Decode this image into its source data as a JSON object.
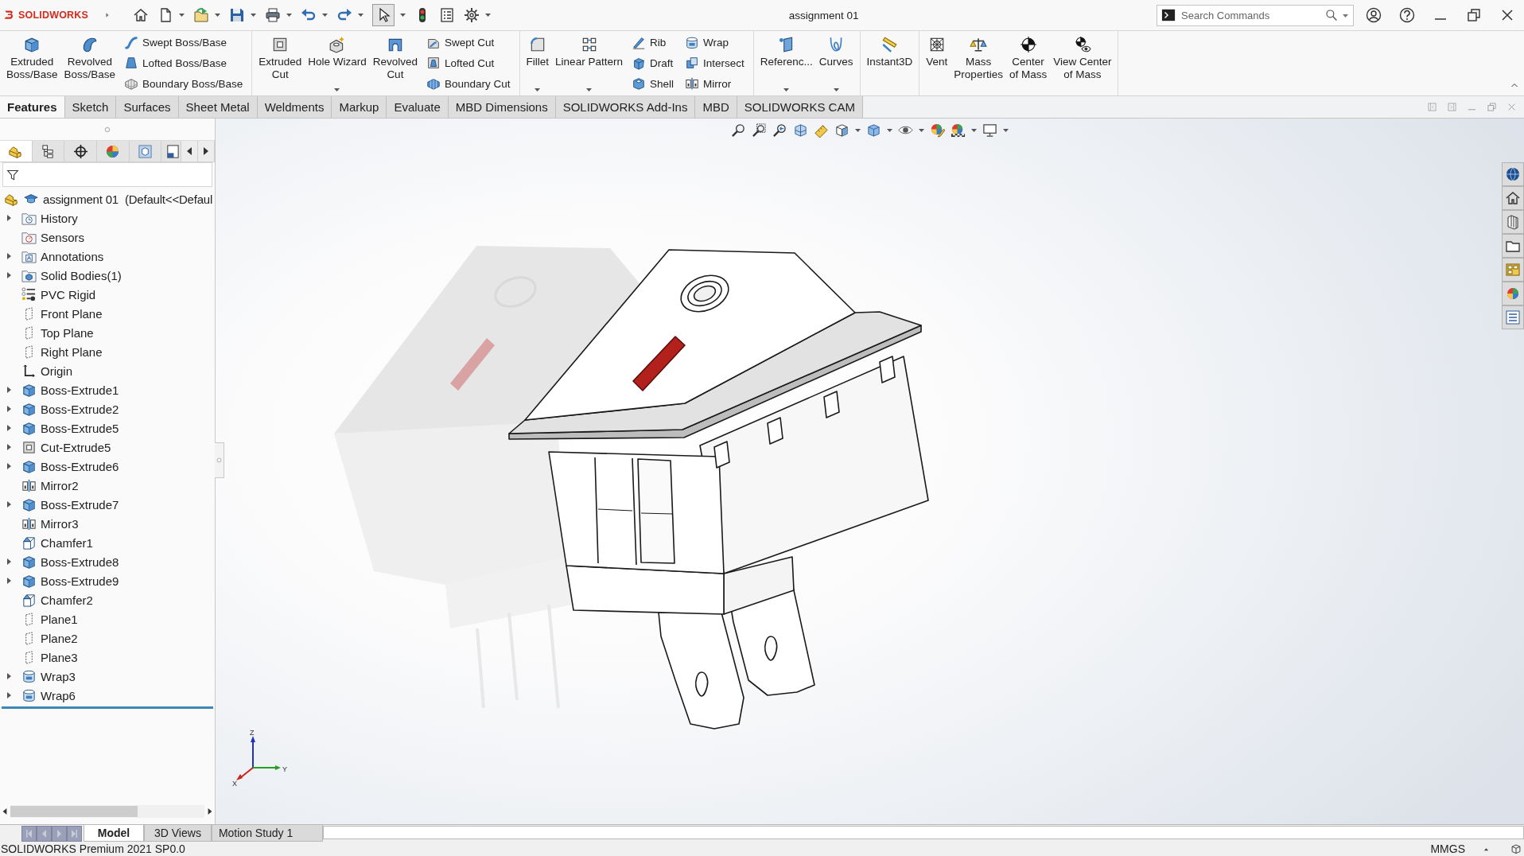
{
  "title_bar": {
    "logo": "SOLIDWORKS",
    "title": "assignment 01",
    "search": {
      "placeholder": "Search Commands"
    }
  },
  "quick_access": [
    {
      "dropdown": false,
      "selected": false
    },
    {
      "dropdown": true,
      "selected": false
    },
    {
      "dropdown": true,
      "selected": false
    },
    {
      "dropdown": true,
      "selected": false
    },
    {
      "dropdown": true,
      "selected": false
    },
    {
      "dropdown": true,
      "selected": false
    },
    {
      "dropdown": true,
      "selected": false
    },
    {
      "dropdown": true,
      "selected": true
    },
    {
      "dropdown": false,
      "selected": false
    },
    {
      "dropdown": false,
      "selected": false
    },
    {
      "dropdown": true,
      "selected": false
    }
  ],
  "ribbon": {
    "groups": [
      {
        "items": [
          {
            "kind": "large",
            "label": "Extruded\nBoss/Base",
            "dropdown": false
          },
          {
            "kind": "large",
            "label": "Revolved\nBoss/Base",
            "dropdown": false
          },
          {
            "kind": "stack",
            "buttons": [
              "Swept Boss/Base",
              "Lofted Boss/Base",
              "Boundary Boss/Base"
            ]
          }
        ]
      },
      {
        "items": [
          {
            "kind": "large",
            "label": "Extruded\nCut",
            "dropdown": false
          },
          {
            "kind": "large",
            "label": "Hole Wizard",
            "dropdown": true
          },
          {
            "kind": "large",
            "label": "Revolved\nCut",
            "dropdown": false
          },
          {
            "kind": "stack",
            "buttons": [
              "Swept Cut",
              "Lofted Cut",
              "Boundary Cut"
            ]
          }
        ]
      },
      {
        "items": [
          {
            "kind": "large",
            "label": "Fillet",
            "dropdown": true
          },
          {
            "kind": "large",
            "label": "Linear Pattern",
            "dropdown": true
          },
          {
            "kind": "stack",
            "buttons": [
              "Rib",
              "Draft",
              "Shell"
            ]
          },
          {
            "kind": "stack",
            "buttons": [
              "Wrap",
              "Intersect",
              "Mirror"
            ]
          }
        ]
      },
      {
        "items": [
          {
            "kind": "large",
            "label": "Referenc...",
            "dropdown": true
          },
          {
            "kind": "large",
            "label": "Curves",
            "dropdown": true
          }
        ]
      },
      {
        "items": [
          {
            "kind": "large",
            "label": "Instant3D",
            "dropdown": false
          }
        ]
      },
      {
        "items": [
          {
            "kind": "large",
            "label": "Vent",
            "dropdown": false
          },
          {
            "kind": "large",
            "label": "Mass\nProperties",
            "dropdown": false
          },
          {
            "kind": "large",
            "label": "Center\nof Mass",
            "dropdown": false
          },
          {
            "kind": "large",
            "label": "View Center\nof Mass",
            "dropdown": false
          }
        ]
      }
    ]
  },
  "command_tabs": [
    {
      "label": "Features",
      "selected": true
    },
    {
      "label": "Sketch",
      "selected": false
    },
    {
      "label": "Surfaces",
      "selected": false
    },
    {
      "label": "Sheet Metal",
      "selected": false
    },
    {
      "label": "Weldments",
      "selected": false
    },
    {
      "label": "Markup",
      "selected": false
    },
    {
      "label": "Evaluate",
      "selected": false
    },
    {
      "label": "MBD Dimensions",
      "selected": false
    },
    {
      "label": "SOLIDWORKS Add-Ins",
      "selected": false
    },
    {
      "label": "MBD",
      "selected": false
    },
    {
      "label": "SOLIDWORKS CAM",
      "selected": false
    }
  ],
  "feature_manager": {
    "tabs": [
      {
        "selected": true
      },
      {
        "selected": false
      },
      {
        "selected": false
      },
      {
        "selected": false
      },
      {
        "selected": false
      },
      {
        "selected": false
      }
    ],
    "tree": {
      "label": "assignment 01  (Default<<Defaul",
      "children": [
        {
          "label": "History",
          "expandable": true
        },
        {
          "label": "Sensors",
          "expandable": false
        },
        {
          "label": "Annotations",
          "expandable": true
        },
        {
          "label": "Solid Bodies(1)",
          "expandable": true
        },
        {
          "label": "PVC Rigid",
          "expandable": false
        },
        {
          "label": "Front Plane",
          "expandable": false
        },
        {
          "label": "Top Plane",
          "expandable": false
        },
        {
          "label": "Right Plane",
          "expandable": false
        },
        {
          "label": "Origin",
          "expandable": false
        },
        {
          "label": "Boss-Extrude1",
          "expandable": true
        },
        {
          "label": "Boss-Extrude2",
          "expandable": true
        },
        {
          "label": "Boss-Extrude5",
          "expandable": true
        },
        {
          "label": "Cut-Extrude5",
          "expandable": true
        },
        {
          "label": "Boss-Extrude6",
          "expandable": true
        },
        {
          "label": "Mirror2",
          "expandable": false
        },
        {
          "label": "Boss-Extrude7",
          "expandable": true
        },
        {
          "label": "Mirror3",
          "expandable": false
        },
        {
          "label": "Chamfer1",
          "expandable": false
        },
        {
          "label": "Boss-Extrude8",
          "expandable": true
        },
        {
          "label": "Boss-Extrude9",
          "expandable": true
        },
        {
          "label": "Chamfer2",
          "expandable": false
        },
        {
          "label": "Plane1",
          "expandable": false
        },
        {
          "label": "Plane2",
          "expandable": false
        },
        {
          "label": "Plane3",
          "expandable": false
        },
        {
          "label": "Wrap3",
          "expandable": true
        },
        {
          "label": "Wrap6",
          "expandable": true
        }
      ]
    }
  },
  "graphics_area": {
    "heads_up_toolbar": [
      {
        "dropdown": false
      },
      {
        "dropdown": false
      },
      {
        "dropdown": false
      },
      {
        "dropdown": false
      },
      {
        "dropdown": false
      },
      {
        "dropdown": true
      },
      {
        "dropdown": true
      },
      {
        "dropdown": true
      },
      {
        "dropdown": false
      },
      {
        "dropdown": true
      },
      {
        "dropdown": true
      }
    ],
    "triad": [
      "Z",
      "Y",
      "X"
    ]
  },
  "bottom_tabs": [
    {
      "label": "Model",
      "selected": true
    },
    {
      "label": "3D Views",
      "selected": false
    },
    {
      "label": "Motion Study 1",
      "selected": false
    }
  ],
  "status_bar": {
    "product": "SOLIDWORKS Premium 2021 SP0.0",
    "units": "MMGS"
  }
}
